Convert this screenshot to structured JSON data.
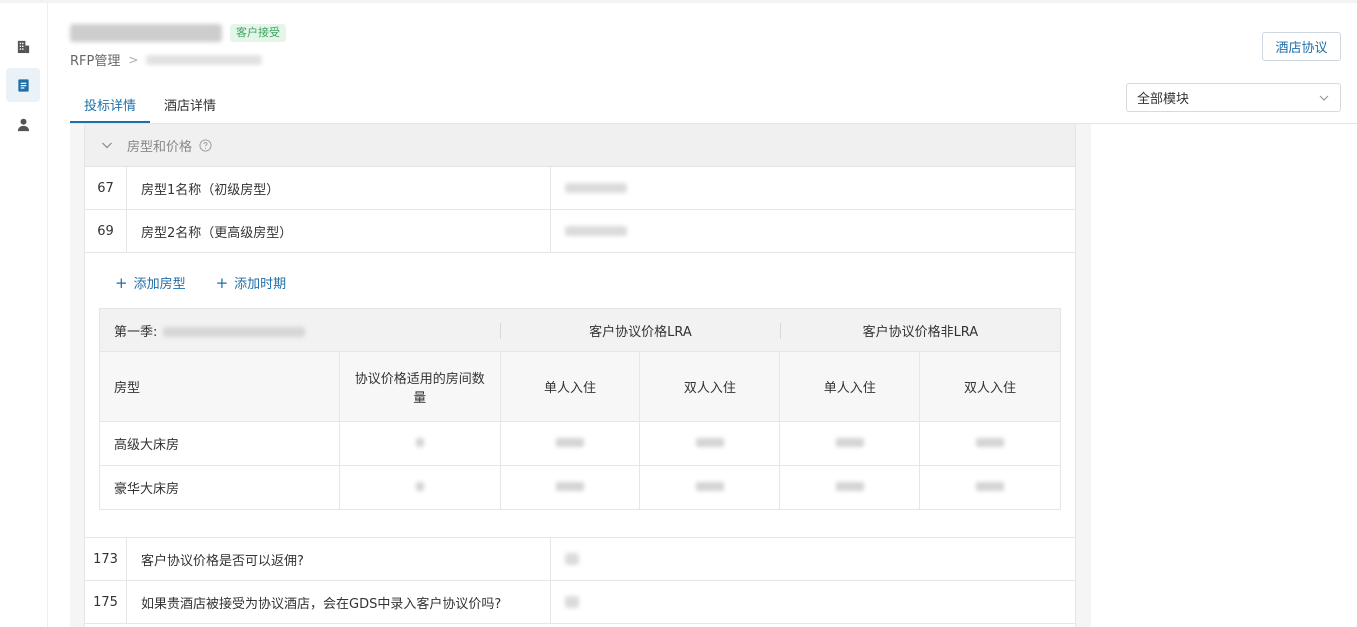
{
  "header": {
    "status_badge": "客户接受",
    "breadcrumb_root": "RFP管理",
    "breadcrumb_sep": ">",
    "agreement_button": "酒店协议"
  },
  "tabs": [
    {
      "label": "投标详情",
      "active": true
    },
    {
      "label": "酒店详情",
      "active": false
    }
  ],
  "module_select": {
    "value": "全部模块"
  },
  "section": {
    "title": "房型和价格",
    "rows": [
      {
        "num": "67",
        "question": "房型1名称（初级房型）"
      },
      {
        "num": "69",
        "question": "房型2名称（更高级房型）"
      }
    ],
    "add_room_type": "添加房型",
    "add_period": "添加时期",
    "rate_table": {
      "season_label": "第一季:",
      "lra_header": "客户协议价格LRA",
      "non_lra_header": "客户协议价格非LRA",
      "col_room_type": "房型",
      "col_room_count": "协议价格适用的房间数量",
      "col_single": "单人入住",
      "col_double": "双人入住",
      "rows": [
        {
          "room": "高级大床房"
        },
        {
          "room": "豪华大床房"
        }
      ]
    },
    "bottom_rows": [
      {
        "num": "173",
        "question": "客户协议价格是否可以返佣?"
      },
      {
        "num": "175",
        "question": "如果贵酒店被接受为协议酒店，会在GDS中录入客户协议价吗?"
      }
    ]
  },
  "colors": {
    "accent": "#1f6fa8",
    "badge_bg": "#e6f5ea",
    "badge_text": "#3ba55c"
  }
}
